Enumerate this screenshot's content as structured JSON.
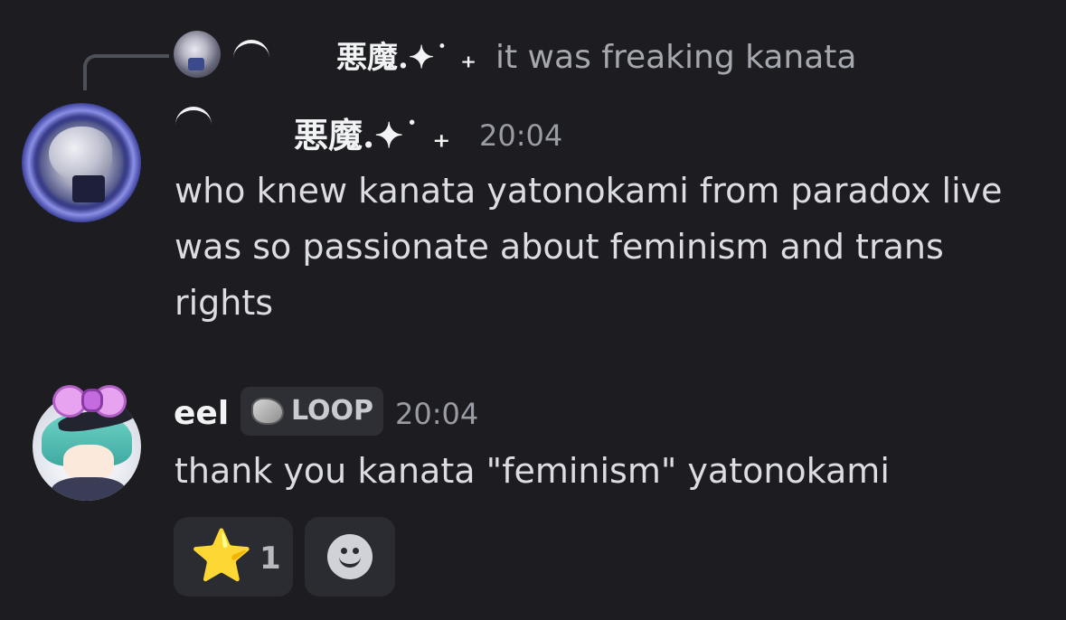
{
  "reply": {
    "author": "悪魔.✦˙ ₊",
    "text": "it was freaking kanata"
  },
  "messages": [
    {
      "author": "悪魔.✦˙ ₊",
      "time": "20:04",
      "text": "who knew kanata yatonokami from paradox live was so passionate about feminism and trans rights"
    },
    {
      "author": "eel",
      "tag": "LOOP",
      "time": "20:04",
      "text": "thank you kanata \"feminism\" yatonokami"
    }
  ],
  "reactions": [
    {
      "emoji": "⭐",
      "count": "1"
    }
  ],
  "icons": {
    "reply_avatar": "user-avatar-icon",
    "avatar1": "user-avatar-icon",
    "avatar2": "user-avatar-icon",
    "tag": "leaf-icon",
    "add_reaction": "smiley-icon"
  },
  "colors": {
    "background": "#1c1c21",
    "text": "#dcdde1",
    "muted": "#9a9ca5",
    "star": "#f7c233"
  }
}
